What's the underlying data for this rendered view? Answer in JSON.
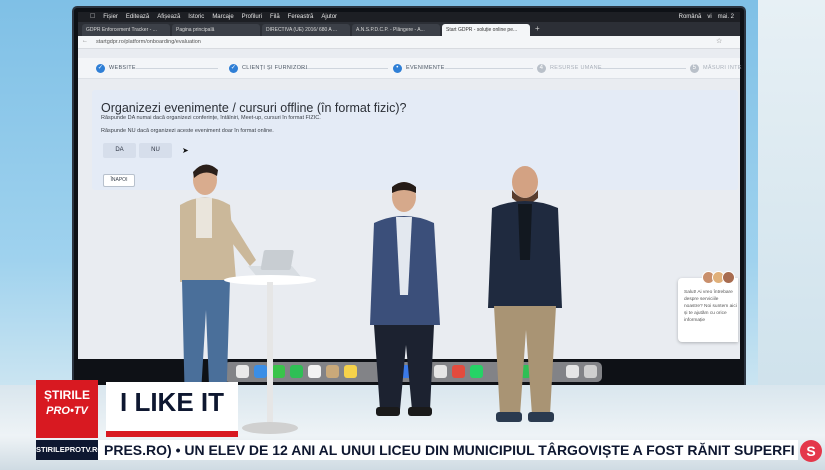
{
  "os_menubar": {
    "items": [
      "Fișier",
      "Editează",
      "Afișează",
      "Istoric",
      "Marcaje",
      "Profiluri",
      "Filă",
      "Fereastră",
      "Ajutor"
    ],
    "right": [
      "Română",
      "vi",
      "mai. 2"
    ]
  },
  "browser": {
    "tabs": [
      {
        "label": "GDPR Enforcement Tracker - ..."
      },
      {
        "label": "Pagina principală"
      },
      {
        "label": "DIRECTIVA (UE) 2016/ 680 A ..."
      },
      {
        "label": "A.N.S.P.D.C.P. - Plângere - A..."
      },
      {
        "label": "Start GDPR - soluție online pe..."
      }
    ],
    "url": "startgdpr.ro/platform/onboarding/evaluation"
  },
  "stepper": {
    "steps": [
      "WEBSITE",
      "CLIENȚI ȘI FURNIZORI",
      "EVENIMENTE",
      "RESURSE UMANE",
      "MĂSURI INTE"
    ],
    "todo_numbers": [
      "4",
      "5"
    ]
  },
  "form": {
    "question": "Organizezi evenimente / cursuri offline (în format fizic)?",
    "hint1": "Răspunde DA numai dacă organizezi conferințe, întâlniri, Meet-up, cursuri în format FIZIC.",
    "hint2": "Răspunde NU dacă organizezi aceste eveniment doar în format online.",
    "yes": "DA",
    "no": "NU",
    "back": "ÎNAPOI"
  },
  "chat": {
    "text": "Salut! Ai vreo întrebare despre serviciile noastre? Noi suntem aici și te ajutăm cu orice informație"
  },
  "overlay": {
    "channel_line1": "ȘTIRILE",
    "channel_line2": "PRO•TV",
    "channel_site": "STIRILEPROTV.RO",
    "show_title": "I LIKE IT",
    "ticker": "PRES.RO)  •  UN ELEV DE 12 ANI AL UNUI LICEU DIN MUNICIPIUL TÂRGOVIȘTE A FOST RĂNIT SUPERFICIAL CU UN BRICEAG",
    "corner_logo": "S"
  },
  "colors": {
    "accent": "#2f7fd6",
    "brand_red": "#d81921",
    "brand_navy": "#0e1730"
  }
}
